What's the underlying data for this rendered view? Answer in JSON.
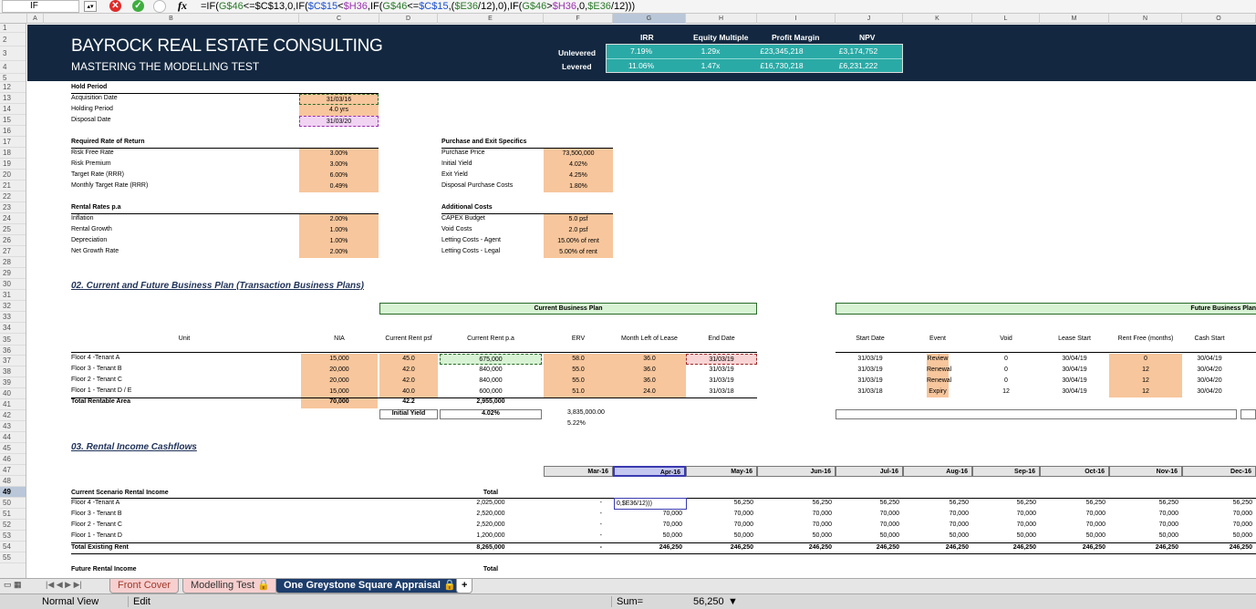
{
  "formula_bar": {
    "name_box": "IF",
    "fx": "fx",
    "formula_parts": [
      {
        "t": "=IF(",
        "c": ""
      },
      {
        "t": "G$46",
        "c": "g"
      },
      {
        "t": "<=",
        "c": ""
      },
      {
        "t": "$C$13",
        "c": ""
      },
      {
        "t": ",0,IF(",
        "c": ""
      },
      {
        "t": "$C$15",
        "c": "b"
      },
      {
        "t": "<",
        "c": ""
      },
      {
        "t": "$H36",
        "c": "p"
      },
      {
        "t": ",IF(",
        "c": ""
      },
      {
        "t": "G$46",
        "c": "g"
      },
      {
        "t": "<=",
        "c": ""
      },
      {
        "t": "$C$15",
        "c": "b"
      },
      {
        "t": ",(",
        "c": ""
      },
      {
        "t": "$E36",
        "c": "g"
      },
      {
        "t": "/12),0),IF(",
        "c": ""
      },
      {
        "t": "G$46",
        "c": "g"
      },
      {
        "t": ">",
        "c": ""
      },
      {
        "t": "$H36",
        "c": "p"
      },
      {
        "t": ",0,",
        "c": ""
      },
      {
        "t": "$E36",
        "c": "g"
      },
      {
        "t": "/12)))",
        "c": ""
      }
    ]
  },
  "columns": [
    "A",
    "B",
    "C",
    "D",
    "E",
    "F",
    "G",
    "H",
    "I",
    "J",
    "K",
    "L",
    "M",
    "N",
    "O"
  ],
  "rows": [
    "1",
    "2",
    "3",
    "4",
    "5",
    "12",
    "13",
    "14",
    "15",
    "16",
    "17",
    "18",
    "19",
    "20",
    "21",
    "22",
    "23",
    "24",
    "25",
    "26",
    "27",
    "28",
    "29",
    "30",
    "31",
    "32",
    "33",
    "34",
    "35",
    "36",
    "37",
    "38",
    "39",
    "40",
    "41",
    "42",
    "43",
    "44",
    "45",
    "46",
    "47",
    "48",
    "49",
    "50",
    "51",
    "52",
    "53",
    "54",
    "55"
  ],
  "banner": {
    "title": "BAYROCK REAL ESTATE CONSULTING",
    "subtitle": "MASTERING THE MODELLING TEST",
    "metric_headers": [
      "IRR",
      "Equity Multiple",
      "Profit Margin",
      "NPV"
    ],
    "row_labels": [
      "Unlevered",
      "Levered"
    ],
    "unlevered": [
      "7.19%",
      "1.29x",
      "£23,345,218",
      "£3,174,752"
    ],
    "levered": [
      "11.06%",
      "1.47x",
      "£16,730,218",
      "£6,231,222"
    ]
  },
  "hold_period": {
    "header": "Hold Period",
    "labels": [
      "Acquisition Date",
      "Holding Period",
      "Disposal Date"
    ],
    "values": [
      "31/03/16",
      "4.0 yrs",
      "31/03/20"
    ]
  },
  "rrr": {
    "header": "Required Rate of Return",
    "labels": [
      "Risk Free Rate",
      "Risk Premium",
      "Target Rate (RRR)",
      "Monthly Target Rate (RRR)"
    ],
    "values": [
      "3.00%",
      "3.00%",
      "6.00%",
      "0.49%"
    ]
  },
  "purchase": {
    "header": "Purchase and Exit Specifics",
    "labels": [
      "Purchase Price",
      "Initial Yield",
      "Exit Yield",
      "Disposal Purchase Costs"
    ],
    "values": [
      "73,500,000",
      "4.02%",
      "4.25%",
      "1.80%"
    ]
  },
  "rental_rates": {
    "header": "Rental Rates p.a",
    "labels": [
      "Inflation",
      "Rental Growth",
      "Depreciation",
      "Net Growth Rate"
    ],
    "values": [
      "2.00%",
      "1.00%",
      "1.00%",
      "2.00%"
    ]
  },
  "additional_costs": {
    "header": "Additional Costs",
    "labels": [
      "CAPEX Budget",
      "Void Costs",
      "Letting Costs - Agent",
      "Letting Costs - Legal"
    ],
    "values": [
      "5.0 psf",
      "2.0 psf",
      "15.00% of rent",
      "5.00% of rent"
    ]
  },
  "section2": {
    "title": "02. Current and Future Business Plan (Transaction Business Plans)",
    "current_plan": "Current Business Plan",
    "future_plan": "Future Business Plan",
    "headers": [
      "Unit",
      "NIA",
      "Current Rent psf",
      "Current Rent p.a",
      "ERV",
      "Month Left of Lease",
      "End Date",
      "Start Date",
      "Event",
      "Void",
      "Lease Start",
      "Rent Free (months)",
      "Cash Start"
    ],
    "units": [
      {
        "unit": "Floor 4 -Tenant A",
        "nia": "15,000",
        "psf": "45.0",
        "pa": "675,000",
        "erv": "58.0",
        "months": "36.0",
        "end": "31/03/19",
        "start": "31/03/19",
        "event": "Review",
        "void": "0",
        "lease_start": "30/04/19",
        "rent_free": "0",
        "cash_start": "30/04/19"
      },
      {
        "unit": "Floor 3 - Tenant B",
        "nia": "20,000",
        "psf": "42.0",
        "pa": "840,000",
        "erv": "55.0",
        "months": "36.0",
        "end": "31/03/19",
        "start": "31/03/19",
        "event": "Renewal",
        "void": "0",
        "lease_start": "30/04/19",
        "rent_free": "12",
        "cash_start": "30/04/20"
      },
      {
        "unit": "Floor 2 - Tenant C",
        "nia": "20,000",
        "psf": "42.0",
        "pa": "840,000",
        "erv": "55.0",
        "months": "36.0",
        "end": "31/03/19",
        "start": "31/03/19",
        "event": "Renewal",
        "void": "0",
        "lease_start": "30/04/19",
        "rent_free": "12",
        "cash_start": "30/04/20"
      },
      {
        "unit": "Floor 1 - Tenant D / E",
        "nia": "15,000",
        "psf": "40.0",
        "pa": "600,000",
        "erv": "51.0",
        "months": "24.0",
        "end": "31/03/18",
        "start": "31/03/18",
        "event": "Expiry",
        "void": "12",
        "lease_start": "30/04/19",
        "rent_free": "12",
        "cash_start": "30/04/20"
      }
    ],
    "total_label": "Total Rentable Area",
    "total_nia": "70,000",
    "total_psf": "42.2",
    "total_pa": "2,955,000",
    "initial_yield_label": "Initial Yield",
    "initial_yield": "4.02%",
    "erv_total": "3,835,000.00",
    "erv_yield": "5.22%"
  },
  "section3": {
    "title": "03. Rental Income Cashflows",
    "months": [
      "Mar-16",
      "Apr-16",
      "May-16",
      "Jun-16",
      "Jul-16",
      "Aug-16",
      "Sep-16",
      "Oct-16",
      "Nov-16",
      "Dec-16"
    ],
    "scenario_header": "Current Scenario Rental Income",
    "total_header": "Total",
    "rows": [
      {
        "label": "Floor 4 -Tenant A",
        "total": "2,025,000",
        "mar": "-",
        "vals": [
          "0,$E36/12)))",
          "56,250",
          "56,250",
          "56,250",
          "56,250",
          "56,250",
          "56,250",
          "56,250",
          "56,250"
        ]
      },
      {
        "label": "Floor 3 - Tenant B",
        "total": "2,520,000",
        "mar": "-",
        "vals": [
          "70,000",
          "70,000",
          "70,000",
          "70,000",
          "70,000",
          "70,000",
          "70,000",
          "70,000",
          "70,000"
        ]
      },
      {
        "label": "Floor 2 - Tenant C",
        "total": "2,520,000",
        "mar": "-",
        "vals": [
          "70,000",
          "70,000",
          "70,000",
          "70,000",
          "70,000",
          "70,000",
          "70,000",
          "70,000",
          "70,000"
        ]
      },
      {
        "label": "Floor 1 - Tenant D",
        "total": "1,200,000",
        "mar": "-",
        "vals": [
          "50,000",
          "50,000",
          "50,000",
          "50,000",
          "50,000",
          "50,000",
          "50,000",
          "50,000",
          "50,000"
        ]
      }
    ],
    "total_row": {
      "label": "Total Existing Rent",
      "total": "8,265,000",
      "mar": "-",
      "vals": [
        "246,250",
        "246,250",
        "246,250",
        "246,250",
        "246,250",
        "246,250",
        "246,250",
        "246,250",
        "246,250"
      ]
    },
    "future_header": "Future Rental Income",
    "future_total": "Total"
  },
  "tabs": {
    "items": [
      "Front Cover",
      "Modelling Test",
      "One Greystone Square Appraisal"
    ],
    "active": "One Greystone Square Appraisal",
    "add": "+"
  },
  "status": {
    "view": "Normal View",
    "mode": "Edit",
    "sum_label": "Sum=",
    "sum_value": "56,250"
  }
}
